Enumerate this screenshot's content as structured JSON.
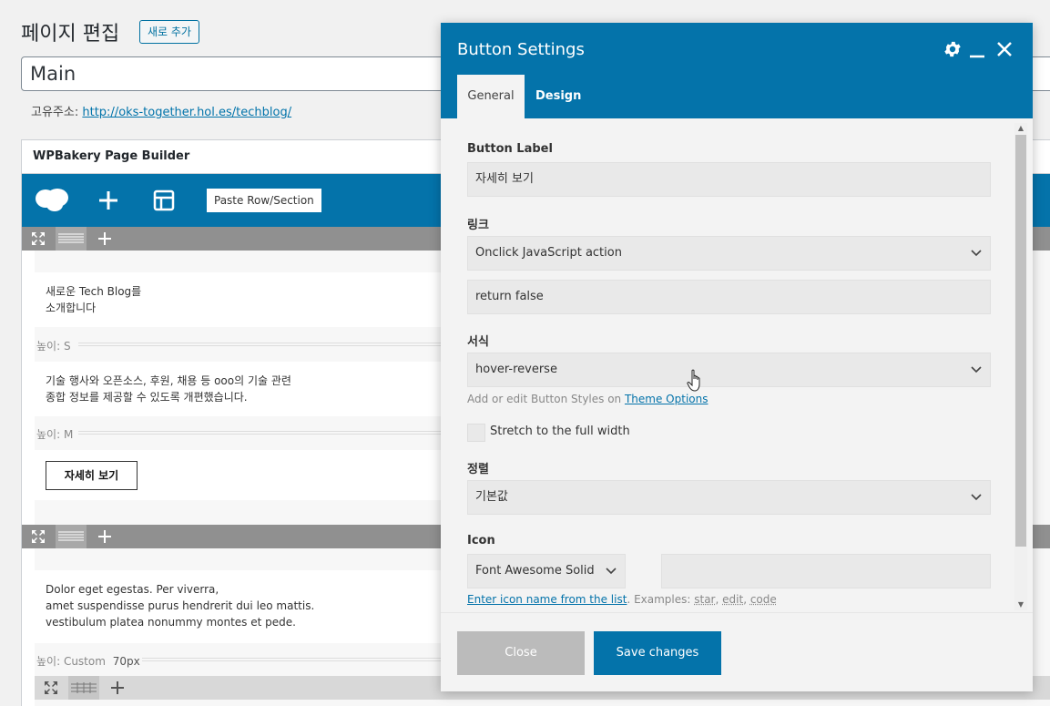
{
  "page": {
    "title": "페이지 편집",
    "add_new": "새로 추가",
    "post_title": "Main",
    "permalink_label": "고유주소:",
    "permalink_url": "http://oks-together.hol.es/techblog/"
  },
  "builder": {
    "title": "WPBakery Page Builder",
    "paste_label": "Paste Row/Section",
    "blocks": {
      "text1_line1": "새로운 Tech Blog를",
      "text1_line2": "소개합니다",
      "spacer1": "높이: S",
      "text2_line1": "기술 행사와 오픈소스, 후원, 채용 등 ooo의 기술 관련",
      "text2_line2": "종합 정보를 제공할 수 있도록 개편했습니다.",
      "spacer2": "높이: M",
      "button_label": "자세히 보기",
      "text3_line1": "Dolor eget egestas. Per viverra,",
      "text3_line2": "amet suspendisse purus hendrerit dui leo mattis.",
      "text3_line3": "vestibulum platea nonummy montes et pede.",
      "spacer3_label": "높이: Custom",
      "spacer3_value": "70px"
    }
  },
  "modal": {
    "title": "Button Settings",
    "tabs": [
      "General",
      "Design"
    ],
    "fields": {
      "button_label_title": "Button Label",
      "button_label_value": "자세히 보기",
      "link_title": "링크",
      "link_value": "Onclick JavaScript action",
      "onclick_value": "return false",
      "style_title": "서식",
      "style_value": "hover-reverse",
      "style_help_prefix": "Add or edit Button Styles on ",
      "style_help_link": "Theme Options",
      "stretch_label": "Stretch to the full width",
      "align_title": "정렬",
      "align_value": "기본값",
      "icon_title": "Icon",
      "icon_library": "Font Awesome Solid",
      "icon_name": "",
      "icon_help_link": "Enter icon name from the list",
      "icon_help_examples": ". Examples: ",
      "icon_ex1": "star",
      "icon_ex2": "edit",
      "icon_ex3": "code"
    },
    "footer": {
      "close": "Close",
      "save": "Save changes"
    }
  },
  "colors": {
    "brand_blue": "#0473aa",
    "link_blue": "#0073aa",
    "close_gray": "#bbbbbb"
  }
}
